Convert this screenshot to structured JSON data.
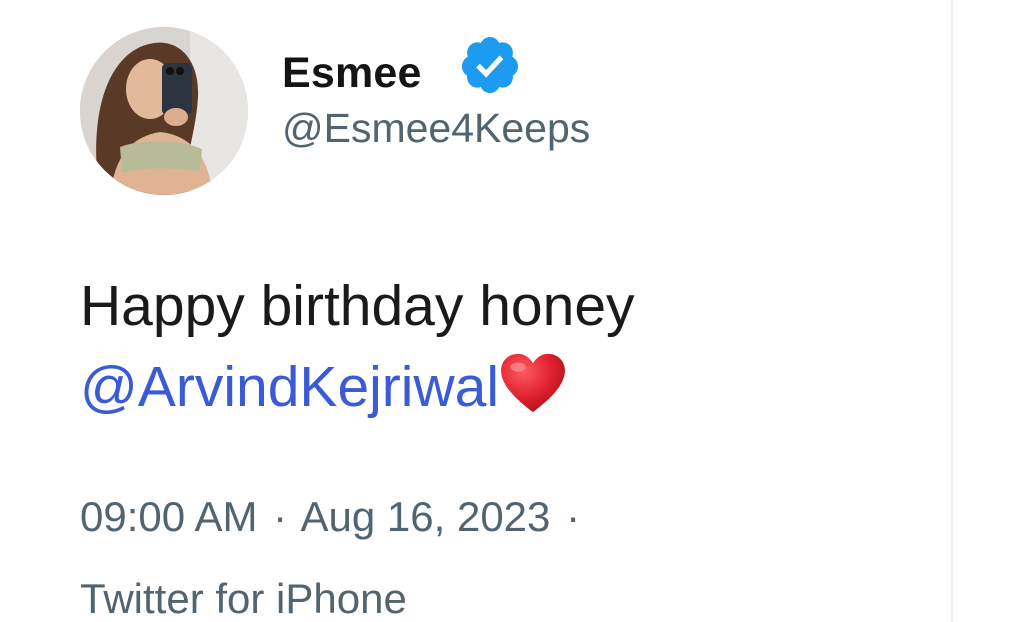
{
  "tweet": {
    "author": {
      "display_name": "Esmee",
      "handle": "@Esmee4Keeps",
      "verified": true,
      "avatar_icon": "profile-photo"
    },
    "text_line1": "Happy birthday honey",
    "mention": "@ArvindKejriwal",
    "trailing_emoji": "heart-icon",
    "time": "09:00 AM",
    "date": "Aug 16, 2023",
    "separator": "·",
    "source": "Twitter for iPhone"
  },
  "colors": {
    "mention": "#3b5bd6",
    "verified": "#1d9bf0",
    "meta": "#536471",
    "heart": "#e0212f"
  }
}
